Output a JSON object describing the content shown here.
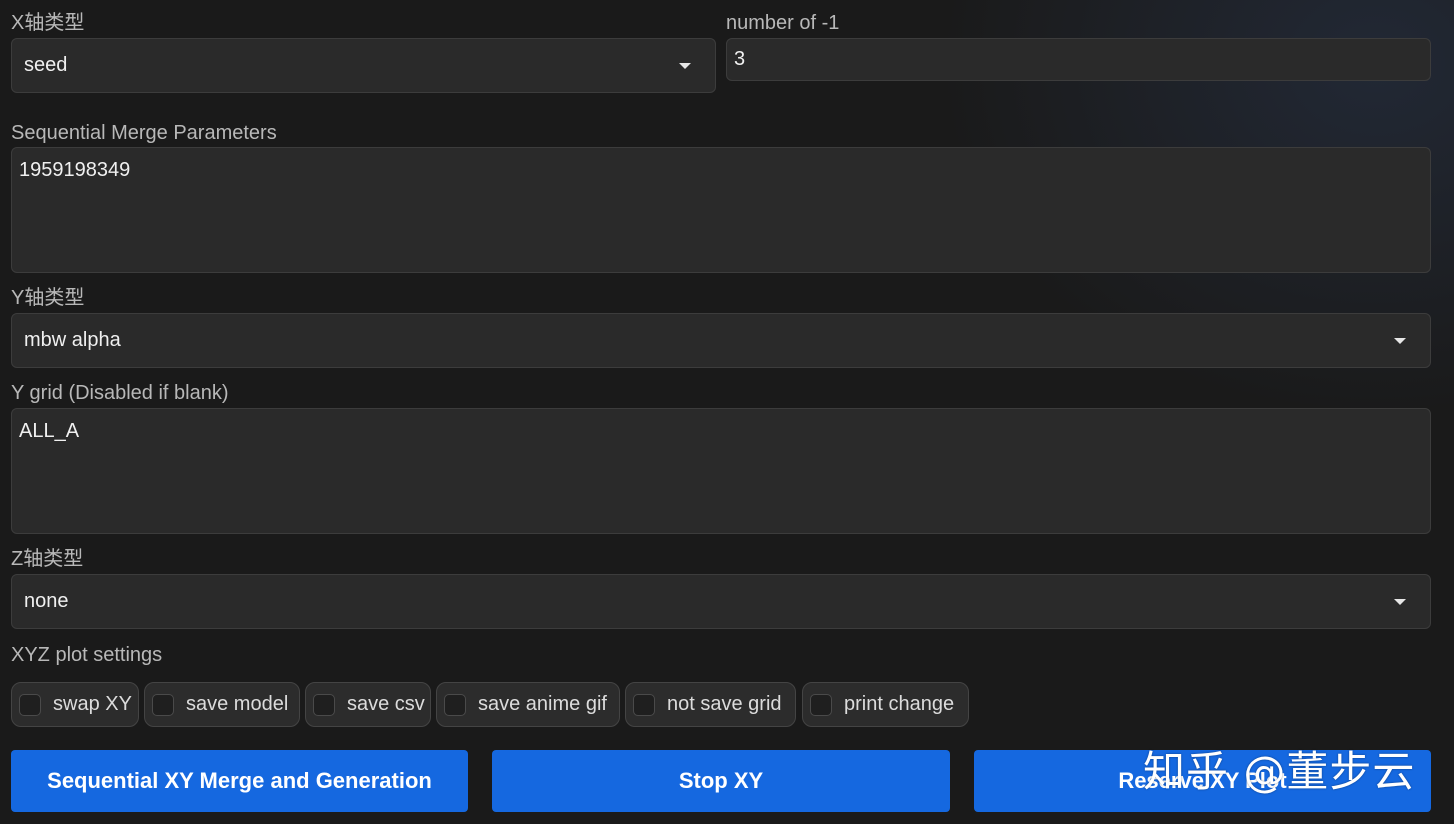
{
  "x_axis": {
    "label": "X轴类型",
    "value": "seed"
  },
  "number_of": {
    "label": "number of -1",
    "value": "3"
  },
  "sequential_merge": {
    "label": "Sequential Merge Parameters",
    "value": "1959198349"
  },
  "y_axis": {
    "label": "Y轴类型",
    "value": "mbw alpha"
  },
  "y_grid": {
    "label": "Y grid (Disabled if blank)",
    "value": "ALL_A"
  },
  "z_axis": {
    "label": "Z轴类型",
    "value": "none"
  },
  "xyz_settings": {
    "label": "XYZ plot settings",
    "options": [
      {
        "label": "swap XY",
        "checked": false
      },
      {
        "label": "save model",
        "checked": false
      },
      {
        "label": "save csv",
        "checked": false
      },
      {
        "label": "save anime gif",
        "checked": false
      },
      {
        "label": "not save grid",
        "checked": false
      },
      {
        "label": "print change",
        "checked": false
      }
    ]
  },
  "buttons": {
    "merge_generate": "Sequential XY Merge and Generation",
    "stop": "Stop XY",
    "reserve": "Reserve XY Plot"
  },
  "watermark": "知乎 @董步云",
  "colors": {
    "accent": "#1568e0",
    "background": "#1a1a1a",
    "field": "#2a2a2a"
  }
}
